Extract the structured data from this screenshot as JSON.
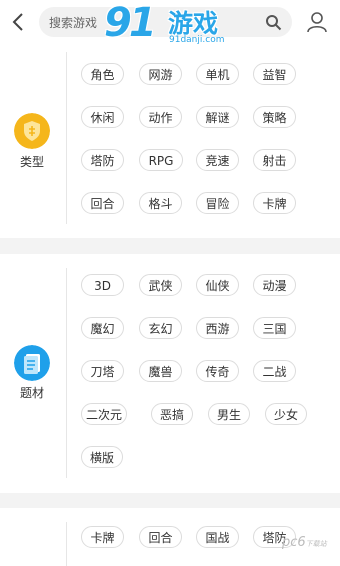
{
  "header": {
    "search_placeholder": "搜索游戏",
    "logo_mark": "91",
    "logo_text": "游戏",
    "logo_sub": "91danji.com"
  },
  "sections": [
    {
      "label": "类型",
      "icon": "game-genre-icon",
      "color": "#f5b61b",
      "tags": [
        "角色",
        "网游",
        "单机",
        "益智",
        "休闲",
        "动作",
        "解谜",
        "策略",
        "塔防",
        "RPG",
        "竞速",
        "射击",
        "回合",
        "格斗",
        "冒险",
        "卡牌"
      ]
    },
    {
      "label": "题材",
      "icon": "document-icon",
      "color": "#1fa0ea",
      "tags": [
        "3D",
        "武侠",
        "仙侠",
        "动漫",
        "魔幻",
        "玄幻",
        "西游",
        "三国",
        "刀塔",
        "魔兽",
        "传奇",
        "二战",
        "二次元",
        "恶搞",
        "男生",
        "少女",
        "横版"
      ]
    },
    {
      "label": "",
      "icon": "",
      "color": "",
      "tags": [
        "卡牌",
        "回合",
        "国战",
        "塔防"
      ]
    }
  ],
  "watermark": {
    "main": "pc6",
    "sub": "下载站"
  }
}
